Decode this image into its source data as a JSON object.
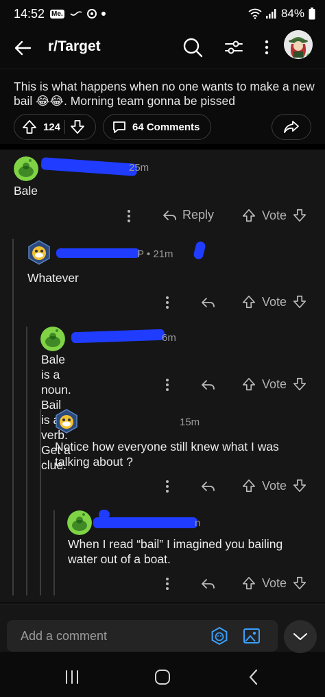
{
  "status_bar": {
    "time": "14:52",
    "me_badge": "Me.",
    "battery": "84%"
  },
  "app_bar": {
    "title": "r/Target"
  },
  "post": {
    "text": "This is what happens when no one wants to make a new bail 😂😂. Morning team gonna be pissed",
    "votes": "124",
    "comments_label": "64 Comments"
  },
  "comments": [
    {
      "age": "25m",
      "body": "Bale",
      "reply_label": "Reply",
      "vote_label": "Vote"
    },
    {
      "age": "P • 21m",
      "body": "Whatever",
      "vote_label": "Vote"
    },
    {
      "age": "6m",
      "body": "Bale is a noun. Bail is a verb. Get a clue.",
      "vote_label": "Vote"
    },
    {
      "age": "15m",
      "body": "Notice how everyone still knew what I was talking about ?",
      "vote_label": "Vote"
    },
    {
      "age": "n",
      "body": "When I read “bail” I imagined you bailing water out of a boat.",
      "vote_label": "Vote"
    }
  ],
  "composer": {
    "placeholder": "Add a comment"
  },
  "colors": {
    "background": "#0b0b0b",
    "comments_bg": "#161616",
    "redaction": "#1f3cff",
    "snoo_green": "#7fd345",
    "accent_blue": "#3aa0ff"
  },
  "icons": [
    "back-arrow-icon",
    "search-icon",
    "filter-icon",
    "more-vertical-icon",
    "upvote-icon",
    "downvote-icon",
    "comment-icon",
    "share-icon",
    "reply-icon",
    "snoo-avatar-icon",
    "emoji-icon",
    "image-icon",
    "chevron-down-icon",
    "recents-icon",
    "home-icon",
    "back-nav-icon"
  ]
}
